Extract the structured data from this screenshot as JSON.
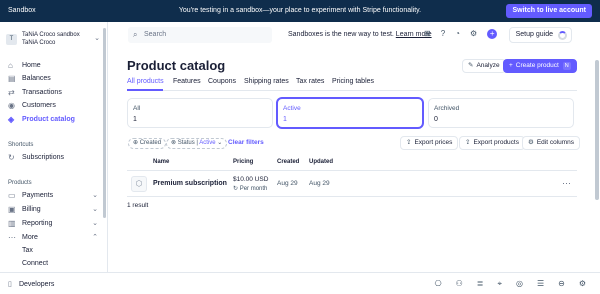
{
  "banner": {
    "sandbox_label": "Sandbox",
    "message": "You're testing in a sandbox—your place to experiment with Stripe functionality.",
    "switch_label": "Switch to live account"
  },
  "account": {
    "avatar": "T",
    "name_line1": "TaNiA Croco sandbox",
    "name_line2": "TaNiA Croco"
  },
  "sidebar": {
    "items": [
      {
        "label": "Home",
        "icon": "home-icon"
      },
      {
        "label": "Balances",
        "icon": "balances-icon"
      },
      {
        "label": "Transactions",
        "icon": "transactions-icon"
      },
      {
        "label": "Customers",
        "icon": "customers-icon"
      },
      {
        "label": "Product catalog",
        "icon": "product-icon"
      }
    ],
    "shortcuts_title": "Shortcuts",
    "shortcuts": [
      {
        "label": "Subscriptions"
      }
    ],
    "products_title": "Products",
    "products": [
      {
        "label": "Payments"
      },
      {
        "label": "Billing"
      },
      {
        "label": "Reporting"
      },
      {
        "label": "More"
      }
    ],
    "more_sub": [
      "Tax",
      "Connect"
    ]
  },
  "bottom": {
    "developers_label": "Developers"
  },
  "topbar": {
    "search_placeholder": "Search",
    "sandbox_msg": "Sandboxes is the new way to test.",
    "learn_more": "Learn more",
    "setup_guide": "Setup guide"
  },
  "page": {
    "title": "Product catalog",
    "analyze_label": "Analyze",
    "create_label": "Create product",
    "create_kbd": "N",
    "tabs": [
      "All products",
      "Features",
      "Coupons",
      "Shipping rates",
      "Tax rates",
      "Pricing tables"
    ],
    "cards": [
      {
        "label": "All",
        "count": "1"
      },
      {
        "label": "Active",
        "count": "1"
      },
      {
        "label": "Archived",
        "count": "0"
      }
    ],
    "filters": {
      "created": "Created",
      "status": "Status",
      "status_value": "Active",
      "clear": "Clear filters"
    },
    "actions": {
      "export_prices": "Export prices",
      "export_products": "Export products",
      "edit_columns": "Edit columns"
    },
    "table": {
      "headers": [
        "Name",
        "Pricing",
        "Created",
        "Updated"
      ],
      "rows": [
        {
          "name": "Premium subscription",
          "price": "$10.00 USD",
          "interval": "Per month",
          "created": "Aug 29",
          "updated": "Aug 29"
        }
      ]
    },
    "result_count": "1 result"
  },
  "colors": {
    "accent": "#635bff",
    "banner": "#0f2d4c"
  }
}
